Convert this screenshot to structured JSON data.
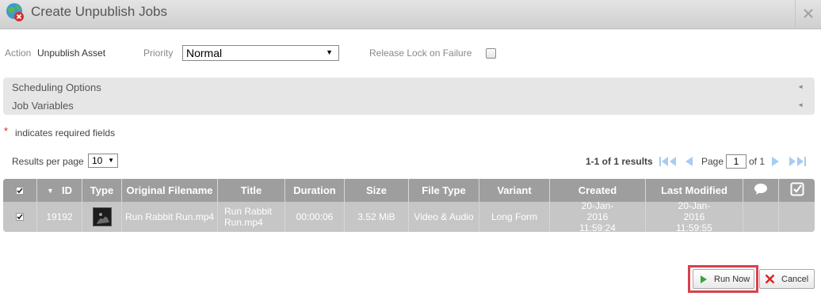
{
  "dialog": {
    "title": "Create Unpublish Jobs",
    "close_icon": "close-icon",
    "title_icon": "globe-remove-icon"
  },
  "action": {
    "label": "Action",
    "value": "Unpublish Asset"
  },
  "priority": {
    "label": "Priority",
    "selected": "Normal"
  },
  "release_lock": {
    "label": "Release Lock on Failure",
    "checked": false
  },
  "accordion": {
    "sections": [
      {
        "label": "Scheduling Options"
      },
      {
        "label": "Job Variables"
      }
    ]
  },
  "required_note": {
    "star": "*",
    "text": "indicates required fields"
  },
  "pagination": {
    "results_per_page_label": "Results per page",
    "results_per_page": "10",
    "results_summary": "1-1 of 1 results",
    "page_label": "Page",
    "page_value": "1",
    "of_label": "of 1"
  },
  "table": {
    "columns": [
      "",
      "ID",
      "Type",
      "Original Filename",
      "Title",
      "Duration",
      "Size",
      "File Type",
      "Variant",
      "Created",
      "Last Modified",
      "",
      ""
    ],
    "rows": [
      {
        "checked": true,
        "id": "19192",
        "type": "video-thumbnail",
        "original_filename": "Run Rabbit Run.mp4",
        "title": "Run Rabbit Run.mp4",
        "duration": "00:00:06",
        "size": "3.52 MiB",
        "file_type": "Video & Audio",
        "variant": "Long Form",
        "created": "20-Jan-2016 11:59:24",
        "last_modified": "20-Jan-2016 11:59:55"
      }
    ]
  },
  "buttons": {
    "run_now": "Run Now",
    "cancel": "Cancel"
  },
  "colors": {
    "highlight": "#d8404c",
    "table_header": "#9e9e9e",
    "table_row": "#c6c6c6",
    "pager_blue": "#4aa3ea"
  }
}
